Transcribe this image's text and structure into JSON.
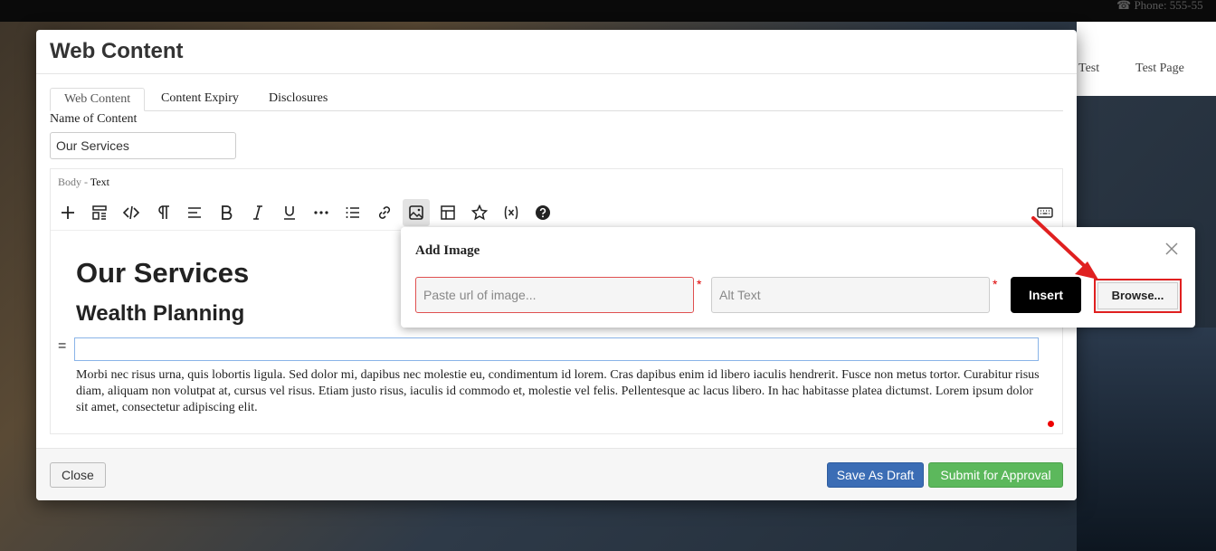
{
  "background": {
    "phone": "☎ Phone: 555-55",
    "nav_links": [
      "Test",
      "Test Page"
    ]
  },
  "modal": {
    "title": "Web Content",
    "tabs": [
      "Web Content",
      "Content Expiry",
      "Disclosures"
    ],
    "name_label": "Name of Content",
    "name_value": "Our Services",
    "body_label": "Body -",
    "body_type": "Text",
    "toolbar_icons": [
      "plus-icon",
      "layout-icon",
      "code-icon",
      "paragraph-icon",
      "align-icon",
      "bold-icon",
      "italic-icon",
      "underline-icon",
      "more-icon",
      "list-icon",
      "link-icon",
      "image-icon",
      "table-icon",
      "star-icon",
      "variable-icon",
      "help-icon",
      "keyboard-icon"
    ],
    "content": {
      "h1": "Our Services",
      "h2": "Wealth Planning",
      "eq": "=",
      "para": "Morbi nec risus urna, quis lobortis ligula. Sed dolor mi, dapibus nec molestie eu, condimentum id lorem. Cras dapibus enim id libero iaculis hendrerit. Fusce non metus tortor. Curabitur risus diam, aliquam non volutpat at, cursus vel risus. Etiam justo risus, iaculis id commodo et, molestie vel felis. Pellentesque ac lacus libero. In hac habitasse platea dictumst. Lorem ipsum dolor sit amet, consectetur adipiscing elit."
    },
    "footer": {
      "close": "Close",
      "save_draft": "Save As Draft",
      "submit": "Submit for Approval"
    }
  },
  "add_image": {
    "title": "Add Image",
    "url_placeholder": "Paste url of image...",
    "alt_placeholder": "Alt Text",
    "required_mark": "*",
    "insert": "Insert",
    "browse": "Browse..."
  },
  "colors": {
    "draft_button": "#3b6db5",
    "submit_button": "#5cb85c",
    "insert_button": "#000000",
    "highlight": "#e02020"
  }
}
